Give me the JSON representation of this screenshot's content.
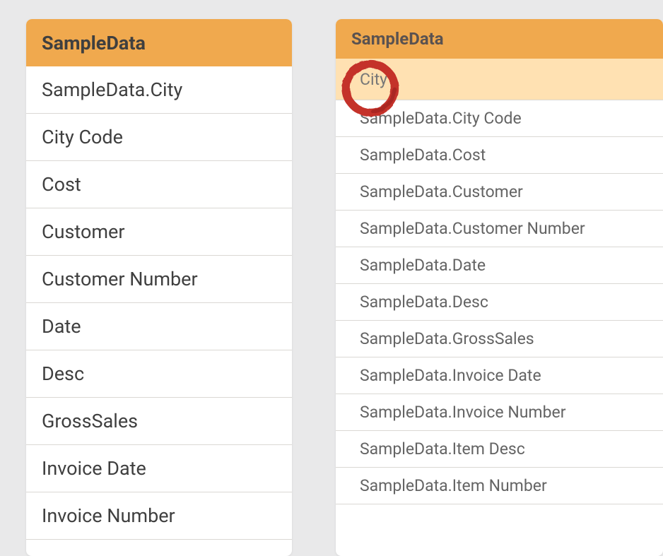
{
  "leftPanel": {
    "title": "SampleData",
    "rows": [
      "SampleData.City",
      "City Code",
      "Cost",
      "Customer",
      "Customer Number",
      "Date",
      "Desc",
      "GrossSales",
      "Invoice Date",
      "Invoice Number"
    ]
  },
  "rightPanel": {
    "title": "SampleData",
    "highlightedRow": "City",
    "rows": [
      "SampleData.City Code",
      "SampleData.Cost",
      "SampleData.Customer",
      "SampleData.Customer Number",
      "SampleData.Date",
      "SampleData.Desc",
      "SampleData.GrossSales",
      "SampleData.Invoice Date",
      "SampleData.Invoice Number",
      "SampleData.Item Desc",
      "SampleData.Item Number"
    ]
  }
}
